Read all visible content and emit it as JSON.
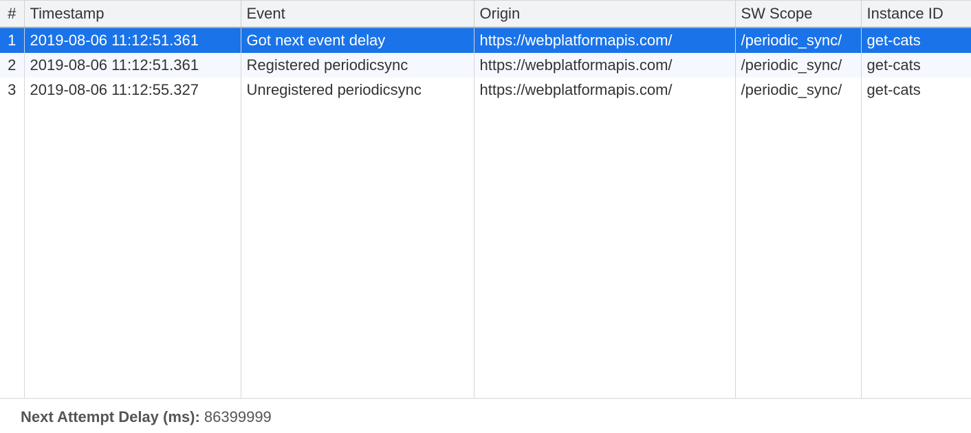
{
  "headers": {
    "index": "#",
    "timestamp": "Timestamp",
    "event": "Event",
    "origin": "Origin",
    "scope": "SW Scope",
    "instanceId": "Instance ID"
  },
  "rows": [
    {
      "n": "1",
      "timestamp": "2019-08-06 11:12:51.361",
      "event": "Got next event delay",
      "origin": "https://webplatformapis.com/",
      "scope": "/periodic_sync/",
      "instanceId": "get-cats",
      "selected": true
    },
    {
      "n": "2",
      "timestamp": "2019-08-06 11:12:51.361",
      "event": "Registered periodicsync",
      "origin": "https://webplatformapis.com/",
      "scope": "/periodic_sync/",
      "instanceId": "get-cats",
      "alt": true
    },
    {
      "n": "3",
      "timestamp": "2019-08-06 11:12:55.327",
      "event": "Unregistered periodicsync",
      "origin": "https://webplatformapis.com/",
      "scope": "/periodic_sync/",
      "instanceId": "get-cats"
    }
  ],
  "footer": {
    "label": "Next Attempt Delay (ms): ",
    "value": "86399999"
  }
}
